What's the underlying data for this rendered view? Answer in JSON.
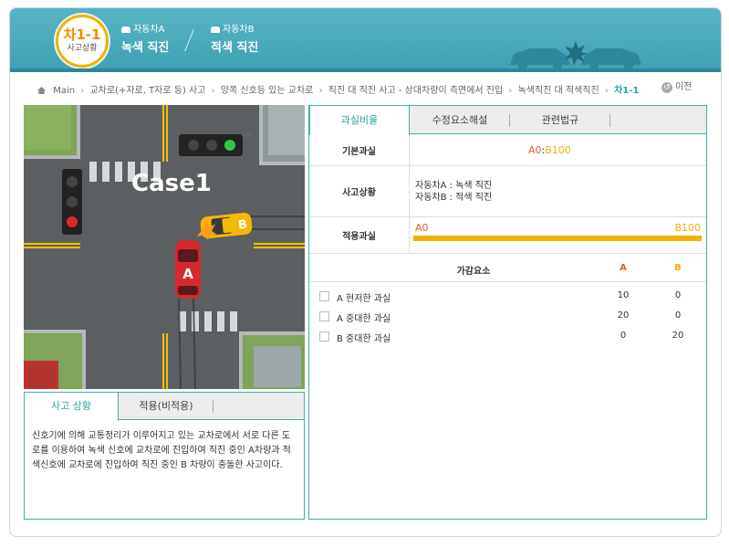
{
  "header": {
    "badge_title": "차1-1",
    "badge_sub": "사고상황",
    "car_a_label": "자동차A",
    "car_a_status": "녹색 직진",
    "car_b_label": "자동차B",
    "car_b_status": "적색 직진"
  },
  "breadcrumb": {
    "items": [
      "Main",
      "교차로(+자로, T자로 등) 사고",
      "양쪽 신호등 있는 교차로",
      "직진 대 직진 사고 - 상대차량이 측면에서 진입",
      "녹색직진 대 적색직진"
    ],
    "current": "차1-1",
    "separator": "›",
    "prev_label": "이전",
    "prev_icon": "↺"
  },
  "scene": {
    "case_label": "Case1",
    "car_a_letter": "A",
    "car_b_letter": "B",
    "colors": {
      "car_a": "#d7282f",
      "car_b": "#f5b800",
      "road": "#595d5f",
      "grass": "#7fa45a"
    }
  },
  "left_tabs": {
    "tab1": "사고 상황",
    "tab2": "적용(비적용)",
    "description": "신호기에 의해 교통정리가 이루어지고 있는 교차로에서 서로 다른 도로를 이용하여 녹색 신호에 교차로에 진입하여 직진 중인 A차량과 적색신호에 교차로에 진입하여 직진 중인 B 차량이 충돌한 사고이다."
  },
  "right_tabs": {
    "tab1": "과실비율",
    "tab2": "수정요소해설",
    "tab3": "관련법규"
  },
  "fault": {
    "base_label": "기본과실",
    "base_a": "A0",
    "base_colon": ":",
    "base_b": "B100",
    "situation_label": "사고상황",
    "situation_a": "자동차A : 녹색 직진",
    "situation_b": "자동차B : 적색 직진",
    "applied_label": "적용과실",
    "applied_a": "A0",
    "applied_b": "B100",
    "applied_b_fraction": 1.0
  },
  "adjust": {
    "head_name": "가감요소",
    "head_a": "A",
    "head_b": "B",
    "rows": [
      {
        "name": "A 현저한 과실",
        "a": "10",
        "b": "0"
      },
      {
        "name": "A 중대한 과실",
        "a": "20",
        "b": "0"
      },
      {
        "name": "B 중대한 과실",
        "a": "0",
        "b": "20"
      }
    ]
  }
}
